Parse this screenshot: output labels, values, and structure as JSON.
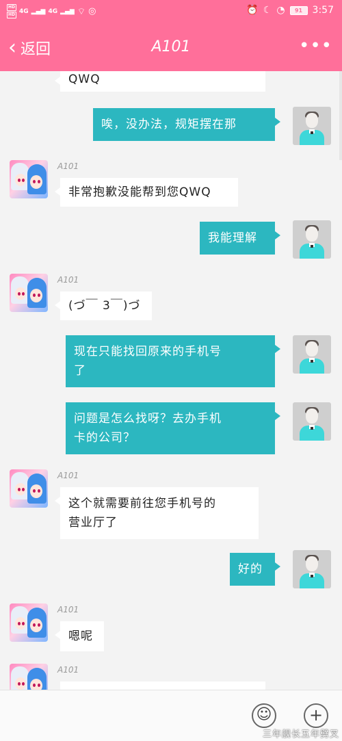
{
  "status_bar": {
    "hd1": "HD",
    "hd2": "HD",
    "net1": "4G",
    "net2": "4G",
    "icons": [
      "wifi-icon",
      "alarm-icon",
      "moon-icon",
      "speedometer-icon"
    ],
    "battery": "91",
    "time": "3:57"
  },
  "header": {
    "back_label": "返回",
    "title": "A101",
    "more_icon": "more-dots-icon"
  },
  "messages": [
    {
      "side": "in",
      "sender": "",
      "text": "QWQ"
    },
    {
      "side": "out",
      "text": "唉，没办法，规矩摆在那"
    },
    {
      "side": "in",
      "sender": "A101",
      "text": "非常抱歉没能帮到您QWQ"
    },
    {
      "side": "out",
      "text": "我能理解"
    },
    {
      "side": "in",
      "sender": "A101",
      "text": "(づ￣ 3￣)づ"
    },
    {
      "side": "out",
      "line1": "现在只能找回原来的手机号",
      "line2": "了"
    },
    {
      "side": "out",
      "line1": "问题是怎么找呀？去办手机",
      "line2": "卡的公司？"
    },
    {
      "side": "in",
      "sender": "A101",
      "line1": "这个就需要前往您手机号的",
      "line2": "营业厅了"
    },
    {
      "side": "out",
      "text": "好的"
    },
    {
      "side": "in",
      "sender": "A101",
      "text": "嗯呢"
    },
    {
      "side": "in",
      "sender": "A101",
      "text": ""
    }
  ],
  "input_bar": {
    "placeholder": "",
    "emoji_icon": "smiley-icon",
    "plus_icon": "plus-icon",
    "watermark": "三年舰长五年劈叉"
  },
  "colors": {
    "brand": "#ff6f9a",
    "outgoing_bubble": "#2cb7c0",
    "incoming_bubble": "#ffffff",
    "background": "#f3f3f3"
  }
}
